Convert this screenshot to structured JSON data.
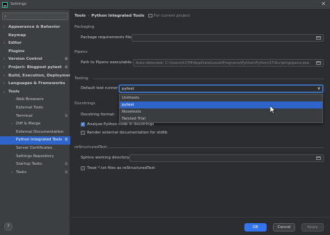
{
  "window": {
    "title": "Settings",
    "close_glyph": "✕"
  },
  "sidebar": {
    "search": {
      "placeholder": "",
      "value": "",
      "icon": "search-icon"
    },
    "items": [
      {
        "label": "Appearance & Behavior",
        "bold": true,
        "expandable": true,
        "level": 0,
        "scope": false
      },
      {
        "label": "Keymap",
        "bold": true,
        "expandable": false,
        "level": 0,
        "scope": false
      },
      {
        "label": "Editor",
        "bold": true,
        "expandable": true,
        "level": 0,
        "scope": false
      },
      {
        "label": "Plugins",
        "bold": true,
        "expandable": false,
        "level": 0,
        "scope": false
      },
      {
        "label": "Version Control",
        "bold": true,
        "expandable": true,
        "level": 0,
        "scope": true
      },
      {
        "label": "Project: Blogpost pytest",
        "bold": true,
        "expandable": true,
        "level": 0,
        "scope": true
      },
      {
        "label": "Build, Execution, Deployment",
        "bold": true,
        "expandable": true,
        "level": 0,
        "scope": false
      },
      {
        "label": "Languages & Frameworks",
        "bold": true,
        "expandable": true,
        "level": 0,
        "scope": false
      },
      {
        "label": "Tools",
        "bold": true,
        "expandable": true,
        "expanded": true,
        "level": 0,
        "scope": false
      },
      {
        "label": "Web Browsers",
        "bold": false,
        "expandable": false,
        "level": 1,
        "scope": false
      },
      {
        "label": "External Tools",
        "bold": false,
        "expandable": false,
        "level": 1,
        "scope": false
      },
      {
        "label": "Terminal",
        "bold": false,
        "expandable": false,
        "level": 1,
        "scope": true
      },
      {
        "label": "Diff & Merge",
        "bold": false,
        "expandable": true,
        "level": 1,
        "scope": false
      },
      {
        "label": "External Documentation",
        "bold": false,
        "expandable": false,
        "level": 1,
        "scope": false
      },
      {
        "label": "Python Integrated Tools",
        "bold": false,
        "expandable": false,
        "level": 1,
        "scope": true,
        "selected": true
      },
      {
        "label": "Server Certificates",
        "bold": false,
        "expandable": false,
        "level": 1,
        "scope": false
      },
      {
        "label": "Settings Repository",
        "bold": false,
        "expandable": false,
        "level": 1,
        "scope": false
      },
      {
        "label": "Startup Tasks",
        "bold": false,
        "expandable": false,
        "level": 1,
        "scope": true
      },
      {
        "label": "Tasks",
        "bold": false,
        "expandable": true,
        "level": 1,
        "scope": true
      }
    ],
    "help_label": "?"
  },
  "breadcrumb": {
    "items": [
      "Tools",
      "Python Integrated Tools"
    ],
    "separator": "›",
    "project_label": "For current project"
  },
  "packaging": {
    "title": "Packaging",
    "requirements_label": "Package requirements file:",
    "requirements_value": ""
  },
  "pipenv": {
    "title": "Pipenv",
    "path_label": "Path to Pipenv executable:",
    "path_value": "Auto-detected: C:\\Users\\X37M\\AppData\\Local\\Programs\\Python\\Python37\\Scripts\\pipenv.exe"
  },
  "testing": {
    "title": "Testing",
    "runner_label": "Default test runner:",
    "runner_value": "pytest",
    "options": [
      "Unittests",
      "pytest",
      "Nosetests",
      "Twisted Trial"
    ],
    "selected_index": 1
  },
  "docstrings": {
    "title": "Docstrings",
    "format_label": "Docstring format:",
    "analyze_label": "Analyze Python code in docstrings",
    "analyze_checked": true,
    "render_label": "Render external documentation for stdlib",
    "render_checked": false
  },
  "restructured": {
    "title": "reStructuredText",
    "sphinx_label": "Sphinx working directory:",
    "sphinx_value": "",
    "treat_label": "Treat *.txt files as reStructuredText",
    "treat_checked": false
  },
  "buttons": {
    "ok": "OK",
    "cancel": "Cancel",
    "apply": "Apply"
  },
  "colors": {
    "accent": "#3574f0",
    "selection": "#2f65ca",
    "background": "#2b2d30",
    "sidebar": "#3c3f41"
  }
}
